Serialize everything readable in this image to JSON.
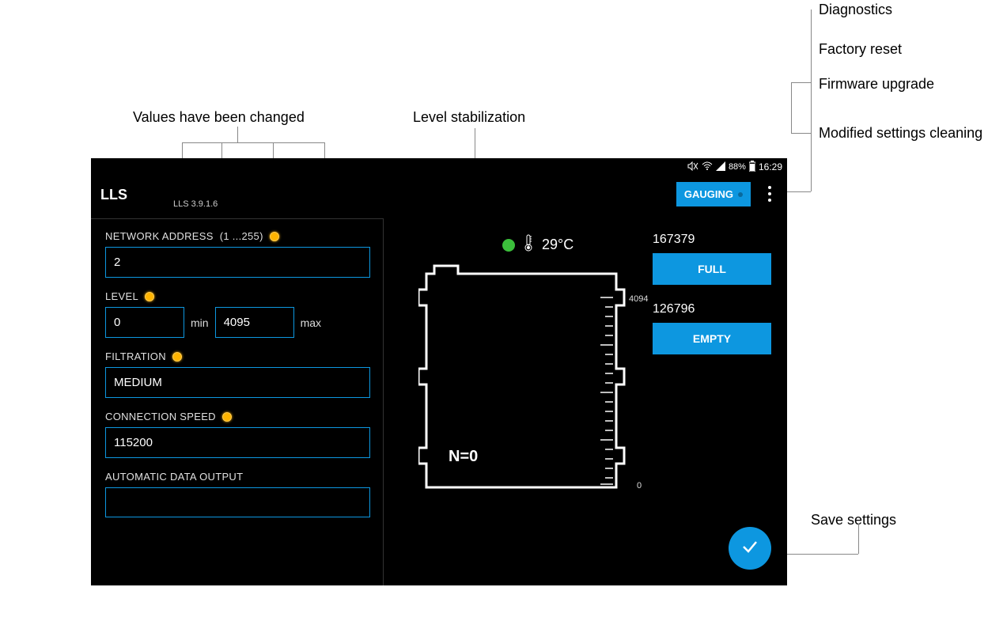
{
  "annotations": {
    "values_changed": "Values have been changed",
    "level_stab": "Level stabilization",
    "diagnostics": "Diagnostics",
    "factory_reset": "Factory reset",
    "firmware_upgrade": "Firmware upgrade",
    "modified_cleaning": "Modified settings cleaning",
    "save_settings": "Save settings"
  },
  "statusbar": {
    "battery": "88%",
    "time": "16:29"
  },
  "header": {
    "title": "LLS",
    "version": "LLS 3.9.1.6",
    "gauging_label": "GAUGING"
  },
  "form": {
    "network_address": {
      "label": "NETWORK ADDRESS",
      "hint": "(1 ...255)",
      "value": "2",
      "changed": true
    },
    "level": {
      "label": "LEVEL",
      "min_value": "0",
      "min_unit": "min",
      "max_value": "4095",
      "max_unit": "max",
      "changed": true
    },
    "filtration": {
      "label": "FILTRATION",
      "value": "MEDIUM",
      "changed": true
    },
    "connection_speed": {
      "label": "CONNECTION SPEED",
      "value": "115200",
      "changed": true
    },
    "auto_output": {
      "label": "AUTOMATIC DATA OUTPUT"
    }
  },
  "tank": {
    "temperature": "29°C",
    "n_label": "N=0",
    "scale_max": "4094",
    "scale_min": "0"
  },
  "calibration": {
    "full_value": "167379",
    "full_label": "FULL",
    "empty_value": "126796",
    "empty_label": "EMPTY"
  }
}
